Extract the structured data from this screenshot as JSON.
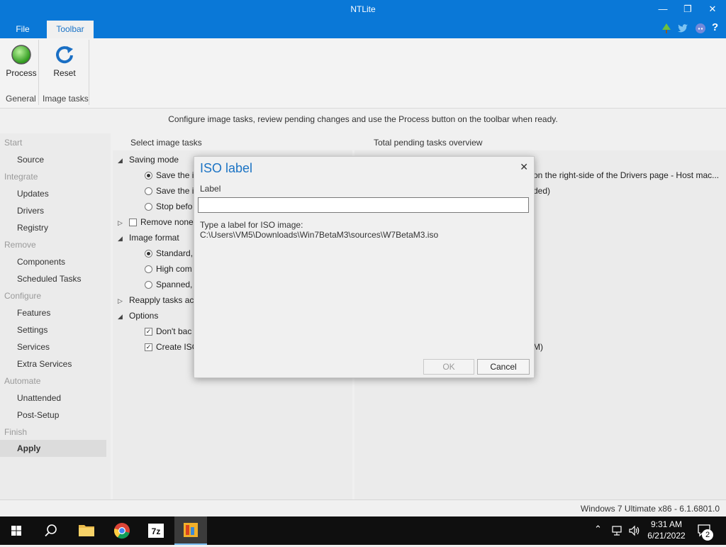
{
  "window": {
    "title": "NTLite"
  },
  "menu": {
    "tabs": [
      {
        "label": "File"
      },
      {
        "label": "Toolbar"
      }
    ]
  },
  "ribbon": {
    "buttons": [
      {
        "label": "Process"
      },
      {
        "label": "Reset"
      }
    ],
    "groups": [
      {
        "label": "General"
      },
      {
        "label": "Image tasks"
      }
    ]
  },
  "hint": "Configure image tasks, review pending changes and use the Process button on the toolbar when ready.",
  "sidebar": {
    "sections": [
      {
        "category": "Start",
        "items": [
          "Source"
        ]
      },
      {
        "category": "Integrate",
        "items": [
          "Updates",
          "Drivers",
          "Registry"
        ]
      },
      {
        "category": "Remove",
        "items": [
          "Components",
          "Scheduled Tasks"
        ]
      },
      {
        "category": "Configure",
        "items": [
          "Features",
          "Settings",
          "Services",
          "Extra Services"
        ]
      },
      {
        "category": "Automate",
        "items": [
          "Unattended",
          "Post-Setup"
        ]
      },
      {
        "category": "Finish",
        "items": [
          "Apply"
        ]
      }
    ]
  },
  "tasks_panel": {
    "header": "Select image tasks",
    "saving_mode": "Saving mode",
    "save_option_1": "Save the in",
    "save_option_2": "Save the in",
    "save_option_3": "Stop befo",
    "remove_none": "Remove none",
    "image_format": "Image format",
    "format_standard": "Standard,",
    "format_high": "High com",
    "format_spanned": "Spanned,",
    "reapply": "Reapply tasks acr",
    "options": "Options",
    "opt_dont_backup": "Don't bac",
    "opt_create_iso": "Create ISO"
  },
  "overview_panel": {
    "header": "Total pending tasks overview",
    "line_1": "on the right-side of the Drivers page - Host mac...",
    "line_2": "ded)",
    "line_3": "M)"
  },
  "dialog": {
    "title": "ISO label",
    "close": "✕",
    "label": "Label",
    "input_value": "",
    "desc_line1": "Type a label for ISO image:",
    "desc_line2": "C:\\Users\\VM5\\Downloads\\Win7BetaM3\\sources\\W7BetaM3.iso",
    "ok": "OK",
    "cancel": "Cancel"
  },
  "statusbar": {
    "text": "Windows 7 Ultimate x86 - 6.1.6801.0"
  },
  "taskbar": {
    "time": "9:31 AM",
    "date": "6/21/2022",
    "notification_count": "2"
  },
  "colors": {
    "accent": "#0a78d7",
    "dialog_title": "#1b73c4"
  }
}
